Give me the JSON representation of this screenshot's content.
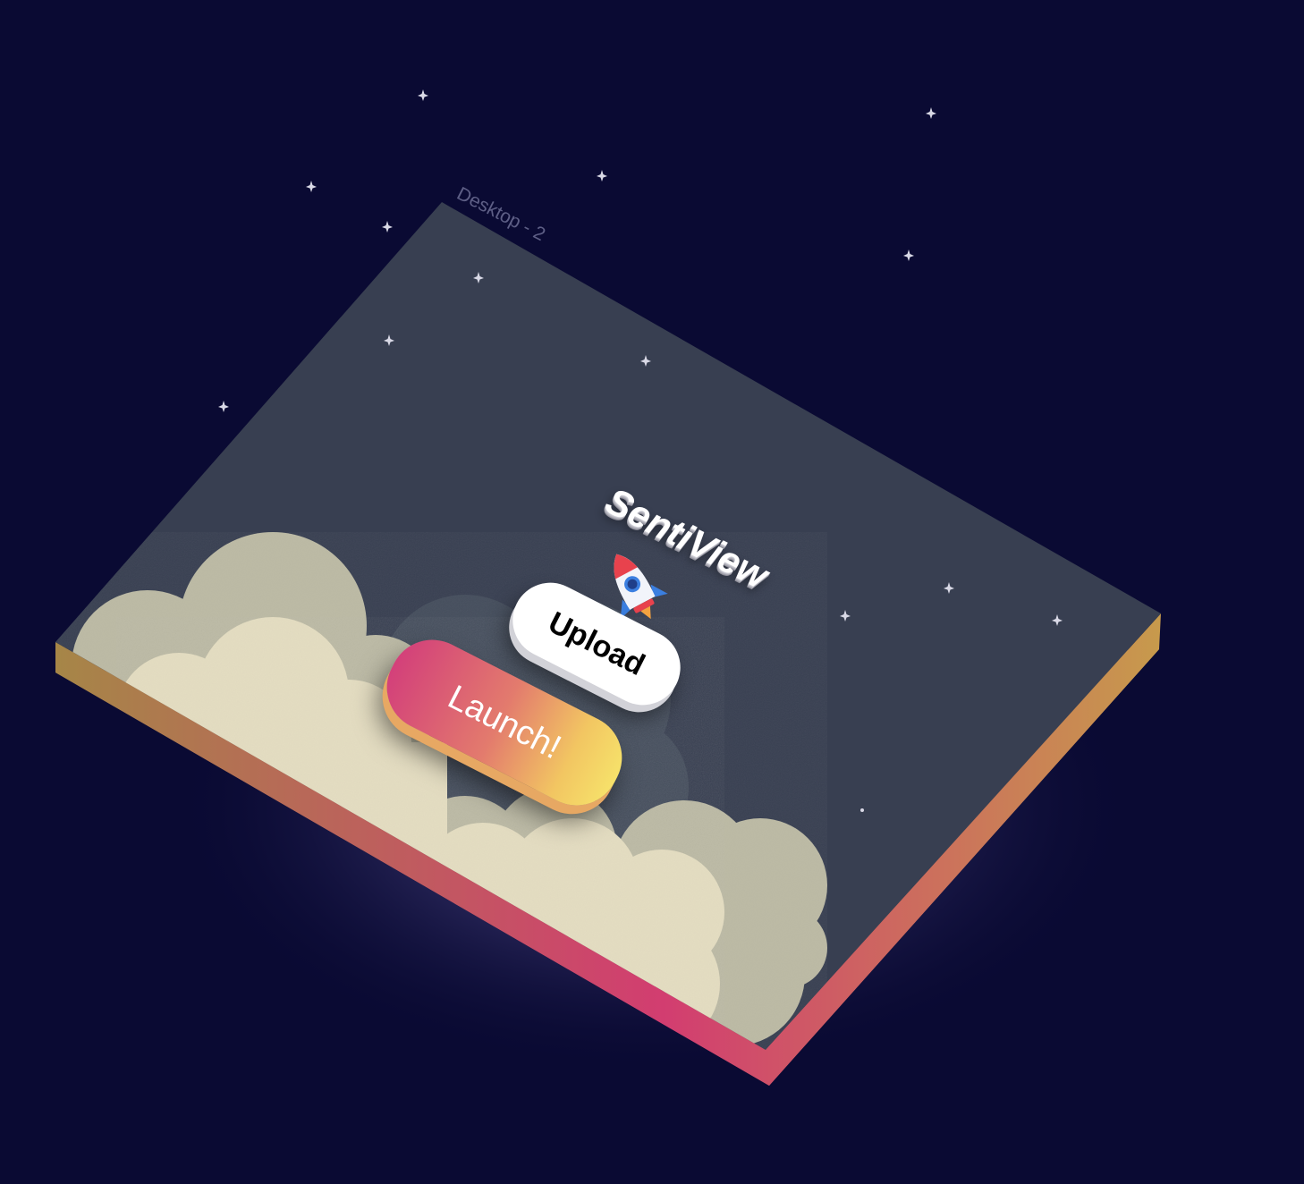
{
  "frame": {
    "label": "Desktop - 2"
  },
  "app": {
    "title": "SentiView"
  },
  "buttons": {
    "upload_label": "Upload",
    "launch_label": "Launch!"
  },
  "icons": {
    "rocket": "rocket-icon",
    "star": "star-icon",
    "cloud": "cloud-icon"
  },
  "colors": {
    "space_background": "#0a0a33",
    "screen_background": "#383f51",
    "cloud": "#e4ddc2",
    "cloud_shadow": "#b9b7a3",
    "gradient_pink": "#d3407a",
    "gradient_orange": "#e37b6d",
    "gradient_yellow": "#f6e16a",
    "upload_button": "#ffffff"
  }
}
